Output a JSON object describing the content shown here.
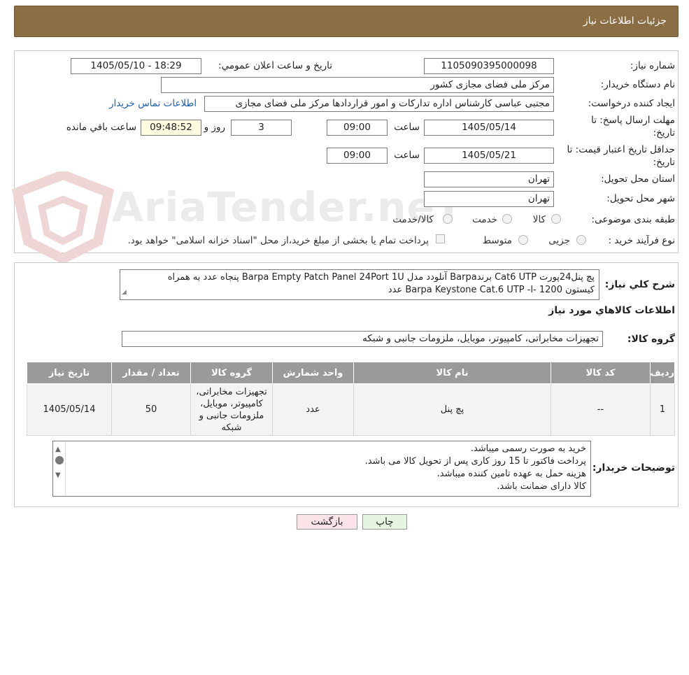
{
  "header": {
    "title": "جزئیات اطلاعات نیاز"
  },
  "labels": {
    "need_number": "شماره نیاز:",
    "announce_datetime": "تاریخ و ساعت اعلان عمومي:",
    "buyer_org": "نام دستگاه خریدار:",
    "requester": "ایجاد کننده درخواست:",
    "deadline_line1": "مهلت ارسال پاسخ: تا",
    "deadline_line2": "تاریخ:",
    "time": "ساعت",
    "days_and": "روز و",
    "remaining": "ساعت باقي مانده",
    "price_validity_line1": "حداقل تاریخ اعتبار قیمت: تا",
    "price_validity_line2": "تاریخ:",
    "province": "استان محل تحویل:",
    "city": "شهر محل تحویل:",
    "category": "طبقه بندی موضوعی:",
    "process": "نوع فرآیند خرید :",
    "general_desc": "شرح كلي نياز:",
    "goods_info": "اطلاعات كالاهاي مورد نياز",
    "goods_group": "گروه كالا:",
    "buyer_notes": "توضیحات خریدار:"
  },
  "values": {
    "need_number": "1105090395000098",
    "announce_datetime": "1405/05/10 - 18:29",
    "buyer_org": "مرکز ملی فضای مجازی کشور",
    "requester": "مجتبی عباسی کارشناس اداره تدارکات و امور قراردادها مرکز ملی فضای مجازی",
    "contact_link": "اطلاعات تماس خریدار",
    "deadline_date": "1405/05/14",
    "deadline_time": "09:00",
    "days_left": "3",
    "time_left": "09:48:52",
    "price_validity_date": "1405/05/21",
    "price_validity_time": "09:00",
    "province": "تهران",
    "city": "تهران",
    "general_desc_line1": "پچ پنل24پورت Cat6 UTP برندBarpa  آنلودد مدل Barpa Empty Patch Panel 24Port 1U پنجاه عدد به همراه",
    "general_desc_line2": "کیستون Barpa Keystone Cat.6 UTP -l- 1200 عدد",
    "goods_group": "تجهیزات مخابراتی، کامپیوتر، موبایل، ملزومات جانبی و شبکه"
  },
  "category_options": [
    "کالا",
    "خدمت",
    "کالا/خدمت"
  ],
  "process_options": [
    "جزیی",
    "متوسط"
  ],
  "treasury_note": "پرداخت تمام یا بخشی از مبلغ خرید،از محل \"اسناد خزانه اسلامی\" خواهد بود.",
  "table": {
    "headers": [
      "رديف",
      "كد كالا",
      "نام كالا",
      "واحد شمارش",
      "گروه كالا",
      "تعداد / مقدار",
      "تاريخ نياز"
    ],
    "rows": [
      [
        "1",
        "--",
        "پچ پنل",
        "عدد",
        "تجهیزات مخابراتی، کامپیوتر، موبایل، ملزومات جانبی و شبکه",
        "50",
        "1405/05/14"
      ]
    ]
  },
  "buyer_notes": [
    "خرید به صورت رسمی میباشد.",
    "پرداخت فاکتور تا 15 روز کاری پس از تحویل کالا می باشد.",
    "هزینه حمل به عهده تامین کننده میباشد.",
    "کالا دارای ضمانت باشد."
  ],
  "buttons": {
    "print": "چاپ",
    "back": "بازگشت"
  },
  "watermark": "AriaTender.neT",
  "colors": {
    "header_bg": "#8c6e45",
    "table_header_bg": "#9a9a9a",
    "link": "#1f5fb2"
  }
}
